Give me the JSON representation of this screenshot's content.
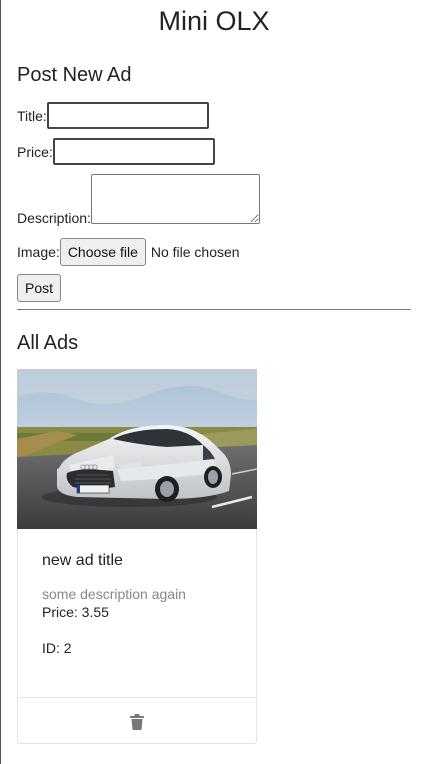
{
  "app": {
    "title": "Mini OLX"
  },
  "form": {
    "heading": "Post New Ad",
    "title_label": "Title:",
    "title_value": "",
    "price_label": "Price:",
    "price_value": "",
    "description_label": "Description:",
    "description_value": "",
    "image_label": "Image:",
    "choose_file_label": "Choose file",
    "file_status": "No file chosen",
    "post_label": "Post"
  },
  "ads": {
    "heading": "All Ads",
    "items": [
      {
        "title": "new ad title",
        "description": "some description again",
        "price": "Price: 3.55",
        "id": "ID: 2",
        "image": "white-car-photo",
        "delete_icon": "trash-icon"
      }
    ]
  },
  "colors": {
    "border_dark": "#444444",
    "muted_text": "#888888",
    "icon_gray": "#777777"
  }
}
